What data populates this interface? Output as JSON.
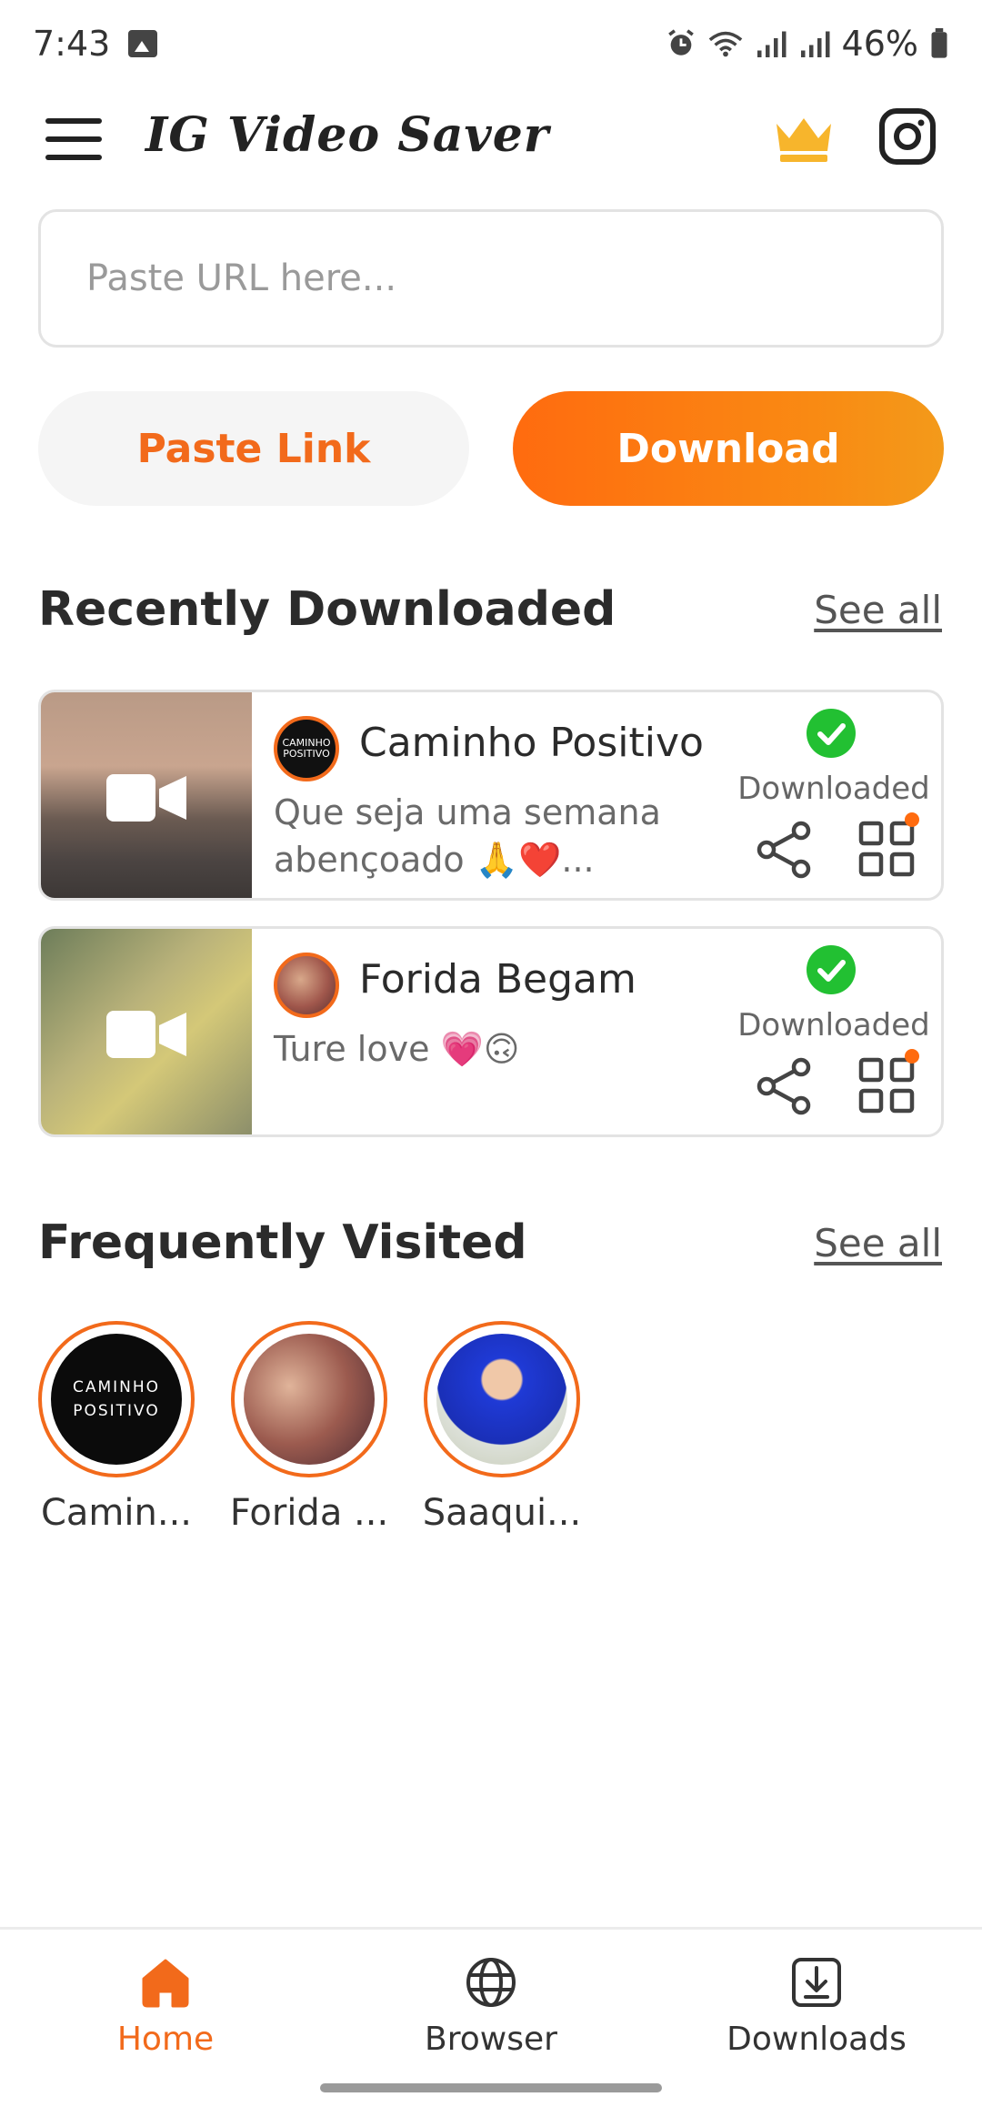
{
  "status_bar": {
    "time": "7:43",
    "battery": "46%"
  },
  "app_bar": {
    "title": "IG Video Saver"
  },
  "url_input": {
    "placeholder": "Paste URL here..."
  },
  "buttons": {
    "paste": "Paste Link",
    "download": "Download"
  },
  "recently_downloaded": {
    "title": "Recently Downloaded",
    "see_all": "See all",
    "items": [
      {
        "name": "Caminho Positivo",
        "caption": "Que seja uma semana abençoado 🙏❤️...",
        "status": "Downloaded"
      },
      {
        "name": "Forida Begam",
        "caption": "Ture love 💗🙃",
        "status": "Downloaded"
      }
    ]
  },
  "frequently_visited": {
    "title": "Frequently Visited",
    "see_all": "See all",
    "items": [
      {
        "label": "Camin...",
        "logo_line1": "CAMINHO",
        "logo_line2": "POSITIVO"
      },
      {
        "label": "Forida ..."
      },
      {
        "label": "Saaqui..."
      }
    ]
  },
  "bottom_nav": {
    "items": [
      {
        "label": "Home",
        "icon": "home-icon",
        "active": true
      },
      {
        "label": "Browser",
        "icon": "globe-icon",
        "active": false
      },
      {
        "label": "Downloads",
        "icon": "download-box-icon",
        "active": false
      }
    ]
  },
  "colors": {
    "accent": "#f26a1b",
    "success": "#22c032"
  }
}
